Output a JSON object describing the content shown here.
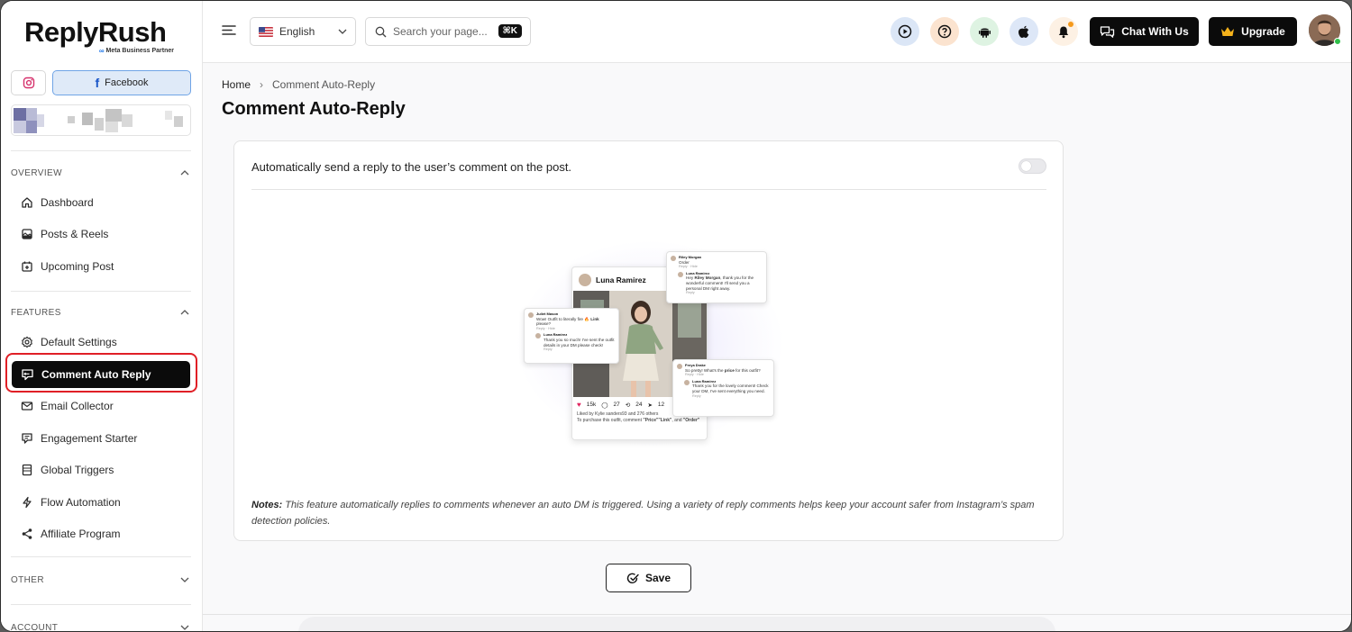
{
  "brand": {
    "name": "ReplyRush",
    "subtitle": "Meta Business Partner",
    "meta_mark": "∞"
  },
  "sidebar": {
    "facebook_label": "Facebook",
    "overview_title": "OVERVIEW",
    "overview_items": [
      {
        "label": "Dashboard",
        "icon": "home-icon"
      },
      {
        "label": "Posts & Reels",
        "icon": "posts-icon"
      },
      {
        "label": "Upcoming Post",
        "icon": "calendar-plus-icon"
      }
    ],
    "features_title": "FEATURES",
    "features_items": [
      {
        "label": "Default Settings",
        "icon": "gear-icon"
      },
      {
        "label": "Comment Auto Reply",
        "icon": "comment-reply-icon",
        "active": true
      },
      {
        "label": "Email Collector",
        "icon": "email-icon"
      },
      {
        "label": "Engagement Starter",
        "icon": "engagement-icon"
      },
      {
        "label": "Global Triggers",
        "icon": "list-icon"
      },
      {
        "label": "Flow Automation",
        "icon": "bolt-icon"
      },
      {
        "label": "Affiliate Program",
        "icon": "share-icon"
      }
    ],
    "other_title": "OTHER",
    "account_title": "ACCOUNT"
  },
  "topbar": {
    "language": "English",
    "search_placeholder": "Search your page...",
    "search_shortcut": "⌘K",
    "chat_label": "Chat With Us",
    "upgrade_label": "Upgrade"
  },
  "breadcrumb": {
    "home": "Home",
    "separator": "›",
    "current": "Comment Auto-Reply"
  },
  "page": {
    "title": "Comment Auto-Reply",
    "card_header": "Automatically send a reply to the user’s comment on the post.",
    "toggle_on": false,
    "notes_label": "Notes:",
    "notes_text": "This feature automatically replies to comments whenever an auto DM is triggered. Using a variety of reply comments helps keep your account safer from Instagram’s spam detection policies.",
    "save_label": "Save"
  },
  "illustration": {
    "post_author": "Luna Ramirez",
    "likes": "15k",
    "comments": "27",
    "reposts": "24",
    "shares": "12",
    "liked_by": "Liked by Kylie sanders93 and 276 others",
    "caption_prefix": "To purchase this outfit, comment ",
    "caption_word_1": "\"Price\"",
    "caption_word_2": "\"Link\"",
    "caption_joiner": ", and ",
    "caption_word_3": "\"Order\"",
    "bubble_top": {
      "user": "Riley Morgan",
      "comment": "Order",
      "meta": "Reply  ·  Hide",
      "reply_user": "Luna Ramirez",
      "reply_prefix": "Hey ",
      "reply_name": "Riley Morgan",
      "reply_text": ", thank you for the wonderful comment! I'll send you a personal DM right away.",
      "reply_meta": "Reply"
    },
    "bubble_left": {
      "user": "Juliet Mason",
      "comment": "Wow! Outfit to literally fire 🔥",
      "comment_bold": "Link",
      "comment_end": " please?",
      "meta": "Reply  ·  Hide",
      "reply_user": "Luna Ramirez",
      "reply_text": "Thank you so much! I've sent the outfit details in your DM please check!",
      "reply_meta": "Reply"
    },
    "bubble_right": {
      "user": "Freya Drake",
      "comment_prefix": "So pretty! What's the ",
      "comment_bold": "price",
      "comment_end": " for this outfit?",
      "meta": "Reply  ·  Hide",
      "reply_user": "Luna Ramirez",
      "reply_text": "Thank you for the lovely comment! Check your DM, I've sent everything you need.",
      "reply_meta": "Reply"
    }
  },
  "colors": {
    "accent_dark": "#0b0b0b",
    "highlight_red": "#e01f26",
    "facebook_blue": "#1a56c8",
    "online_green": "#2fbf4a"
  }
}
